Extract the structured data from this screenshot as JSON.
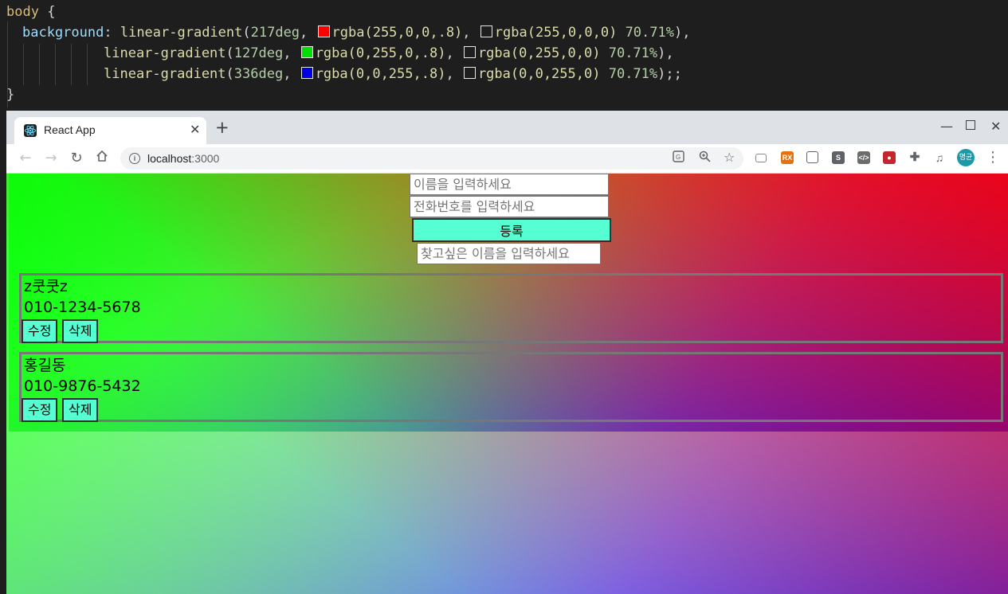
{
  "editor": {
    "selector": "body",
    "open_brace": "{",
    "close_brace": "}",
    "property": "background",
    "fn": "linear-gradient",
    "lines": [
      {
        "angle": "217deg",
        "color1": "rgba(255,0,0,.8)",
        "swatch1": "#ff0000",
        "color2": "rgba(255,0,0,0)",
        "stop": "70.71%",
        "end": "),"
      },
      {
        "angle": "127deg",
        "color1": "rgba(0,255,0,.8)",
        "swatch1": "#00e000",
        "color2": "rgba(0,255,0,0)",
        "stop": "70.71%",
        "end": "),"
      },
      {
        "angle": "336deg",
        "color1": "rgba(0,0,255,.8)",
        "swatch1": "#0000e0",
        "color2": "rgba(0,0,255,0)",
        "stop": "70.71%",
        "end": ");;"
      }
    ]
  },
  "browser": {
    "tab_title": "React App",
    "url_host": "localhost",
    "url_port": ":3000",
    "profile_label": "명균",
    "icons": {
      "back": "back-arrow-icon",
      "forward": "forward-arrow-icon",
      "reload": "reload-icon",
      "home": "home-icon"
    }
  },
  "form": {
    "name_placeholder": "이름을 입력하세요",
    "phone_placeholder": "전화번호를 입력하세요",
    "register_label": "등록",
    "search_placeholder": "찾고싶은 이름을 입력하세요"
  },
  "contacts": [
    {
      "name": "z쿳쿳z",
      "phone": "010-1234-5678"
    },
    {
      "name": "홍길동",
      "phone": "010-9876-5432"
    }
  ],
  "card_buttons": {
    "edit": "수정",
    "delete": "삭제"
  },
  "colors": {
    "button_accent": "#56ffd2",
    "card_border": "#777777"
  }
}
